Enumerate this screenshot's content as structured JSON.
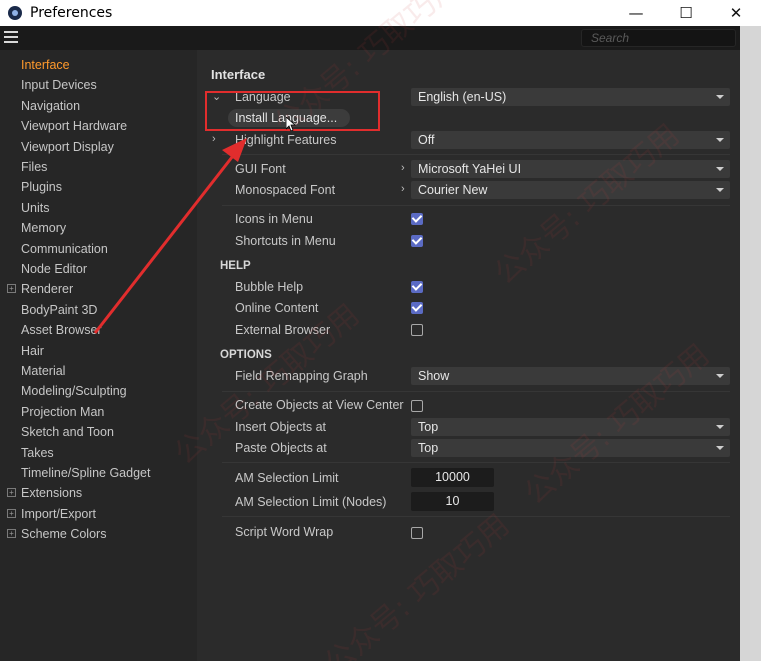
{
  "window": {
    "title": "Preferences",
    "controls": {
      "minimize": "—",
      "maximize": "☐",
      "close": "✕"
    }
  },
  "toolbar": {
    "search_placeholder": "Search"
  },
  "sidebar": {
    "items": [
      {
        "label": "Interface",
        "active": true,
        "expandable": false
      },
      {
        "label": "Input Devices",
        "expandable": false
      },
      {
        "label": "Navigation",
        "expandable": false
      },
      {
        "label": "Viewport Hardware",
        "expandable": false
      },
      {
        "label": "Viewport Display",
        "expandable": false
      },
      {
        "label": "Files",
        "expandable": false
      },
      {
        "label": "Plugins",
        "expandable": false
      },
      {
        "label": "Units",
        "expandable": false
      },
      {
        "label": "Memory",
        "expandable": false
      },
      {
        "label": "Communication",
        "expandable": false
      },
      {
        "label": "Node Editor",
        "expandable": false
      },
      {
        "label": "Renderer",
        "expandable": true
      },
      {
        "label": "BodyPaint 3D",
        "expandable": false
      },
      {
        "label": "Asset Browser",
        "expandable": false
      },
      {
        "label": "Hair",
        "expandable": false
      },
      {
        "label": "Material",
        "expandable": false
      },
      {
        "label": "Modeling/Sculpting",
        "expandable": false
      },
      {
        "label": "Projection Man",
        "expandable": false
      },
      {
        "label": "Sketch and Toon",
        "expandable": false
      },
      {
        "label": "Takes",
        "expandable": false
      },
      {
        "label": "Timeline/Spline Gadget",
        "expandable": false
      },
      {
        "label": "Extensions",
        "expandable": true
      },
      {
        "label": "Import/Export",
        "expandable": true
      },
      {
        "label": "Scheme Colors",
        "expandable": true
      }
    ],
    "expander_glyph": "+"
  },
  "main": {
    "title": "Interface",
    "language": {
      "label": "Language",
      "value": "English (en-US)"
    },
    "install_language": "Install Language...",
    "highlight_features": {
      "label": "Highlight Features",
      "value": "Off"
    },
    "gui_font": {
      "label": "GUI Font",
      "value": "Microsoft YaHei UI"
    },
    "mono_font": {
      "label": "Monospaced Font",
      "value": "Courier New"
    },
    "icons_in_menu": {
      "label": "Icons in Menu",
      "checked": true
    },
    "shortcuts_in_menu": {
      "label": "Shortcuts in Menu",
      "checked": true
    },
    "help_group": "HELP",
    "bubble_help": {
      "label": "Bubble Help",
      "checked": true
    },
    "online_content": {
      "label": "Online Content",
      "checked": true
    },
    "external_browser": {
      "label": "External Browser",
      "checked": false
    },
    "options_group": "OPTIONS",
    "field_remapping": {
      "label": "Field Remapping Graph",
      "value": "Show"
    },
    "create_objects": {
      "label": "Create Objects at View Center",
      "checked": false
    },
    "insert_objects": {
      "label": "Insert Objects at",
      "value": "Top"
    },
    "paste_objects": {
      "label": "Paste Objects at",
      "value": "Top"
    },
    "am_limit": {
      "label": "AM Selection Limit",
      "value": "10000"
    },
    "am_limit_nodes": {
      "label": "AM Selection Limit (Nodes)",
      "value": "10"
    },
    "script_wrap": {
      "label": "Script Word Wrap",
      "checked": false
    }
  },
  "watermark": {
    "text": "公众号: 巧取巧用"
  },
  "colors": {
    "accent_active": "#ff9a2c",
    "checkbox_on": "#5b6bc4",
    "annotation_red": "#e12d2d"
  }
}
